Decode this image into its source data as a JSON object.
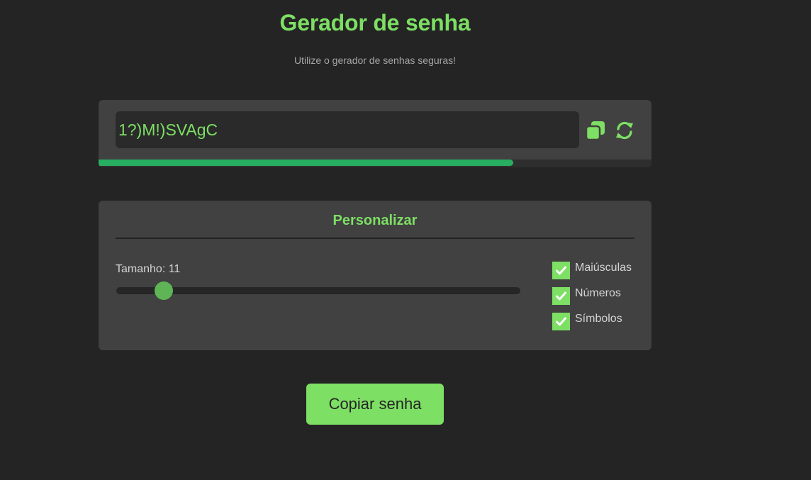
{
  "header": {
    "title": "Gerador de senha",
    "subtitle": "Utilize o gerador de senhas seguras!"
  },
  "password": {
    "value": "1?)M!)SVAgC",
    "strength_fraction": 0.75,
    "copy_icon": "copy-icon",
    "refresh_icon": "refresh-icon"
  },
  "customize": {
    "title": "Personalizar",
    "length_label": "Tamanho: 11",
    "length_value": 11,
    "length_min": 4,
    "length_max": 64,
    "options": [
      {
        "label": "Maiúsculas",
        "checked": true
      },
      {
        "label": "Números",
        "checked": true
      },
      {
        "label": "Símbolos",
        "checked": true
      }
    ]
  },
  "actions": {
    "copy_label": "Copiar senha"
  },
  "colors": {
    "background": "#242424",
    "card": "#414141",
    "accent": "#7ddf64",
    "strength": "#27ae60"
  }
}
